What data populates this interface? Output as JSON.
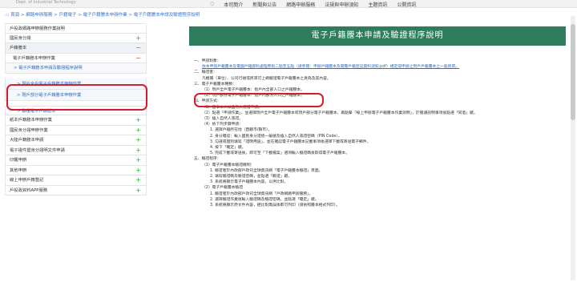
{
  "topbar": {
    "site_small_text": "Dept. of Industrial Technology",
    "nav": [
      "本司簡介",
      "新聞與公告",
      "網路申辦服務",
      "法規與申辦須知",
      "主題資訊",
      "公開資訊"
    ]
  },
  "breadcrumb": "::: 首頁 > 網路申辦服務 > 戶籍電子 > 電子戶籍謄本申辦作業 > 電子戶籍謄本申請及驗證程序說明",
  "sidebar": {
    "items": [
      {
        "label": "戶役政網路申辦服務作業說明",
        "sign": ""
      },
      {
        "label": "國民身分證",
        "sign": "+"
      },
      {
        "label": "戶籍謄本",
        "sign": "−"
      },
      {
        "label": "電子戶籍謄本申辦作業",
        "sign": "−"
      },
      {
        "label": "> 電子戶籍謄本申請及驗證程序說明",
        "sign": ""
      },
      {
        "label": "> 現戶全戶電子戶籍謄本申辦作業",
        "sign": ""
      },
      {
        "label": "> 現戶部分電子戶籍謄本申辦作業",
        "sign": ""
      },
      {
        "label": "> 驗證電子戶籍謄本",
        "sign": ""
      },
      {
        "label": "紙本戶籍謄本申辦作業",
        "sign": "+"
      },
      {
        "label": "國民身分證申辦作業",
        "sign": "+"
      },
      {
        "label": "大陸戶籍謄本申請",
        "sign": "+"
      },
      {
        "label": "電子證件暨身分證明文件申請",
        "sign": "+"
      },
      {
        "label": "印鑑申辦",
        "sign": "+"
      },
      {
        "label": "其他申辦",
        "sign": "+"
      },
      {
        "label": "線上申辦戶籍登記",
        "sign": "+"
      },
      {
        "label": "戶役政資料APP服務",
        "sign": "+"
      }
    ]
  },
  "main": {
    "banner": "電子戶籍謄本申請及驗證程序說明",
    "lines": [
      "一、申請對象：",
      "依本申辦戶籍謄本及電腦戶籍資料處理原則二點至五點（請參閱：申辦戶籍謄本及閱覽戶籍登記資料須知.pdf）規定得申辦之現戶戶籍謄本之一般民眾。",
      "二、驗證者：",
      "凡機關（單位）、公司行號或民眾可上網驗證電子戶籍謄本之真偽及其內容。",
      "三、電子戶籍謄本種類：",
      "（1）現戶全戶電子戶籍謄本：指戶內全部人口之戶籍謄本。",
      "（2）現戶部分電子戶籍謄本：指戶內部分人口之戶籍謄本。",
      "四、申請方式：",
      "（1）當事本人以自然人憑證申請。",
      "（2）點選「申請作業」，並選擇現戶全戶電子戶籍謄本或現戶部分電子戶籍謄本，再點擊「線上申辦電子戶籍謄本作業說明」，於閱讀說明事項後點選「同意」鍵。",
      "（3）插入自然人憑證。",
      "（4）依下列步驟申請：",
      "1. 選擇戶籍所在地（直轄市/縣市）。",
      "2. 身分確認：輸入國民身分證統一編號及插入自然人憑證密碼（PIN Code）。",
      "3. 勾選或個別填寫「證明用途」，並在確認電子戶籍謄本記載事項後選擇下載或寄送電子郵件。",
      "4. 按下「確定」鍵。",
      "5. 完成下載或寄送後，即可至「下載檔案」選項輸入驗證碼後取得電子戶籍謄本。",
      "五、驗證程序：",
      "（1）電子戶籍謄本驗證機制：",
      "1. 驗證者於內政部戶政司全球資訊網「電子戶籍謄本驗證」頁面。",
      "2. 填寫驗證碼及驗證密碼，並點選「驗證」鍵。",
      "3. 系統將顯示電子戶籍謄本內容，以供比對。",
      "（2）電子戶籍謄本驗證",
      "1. 驗證者於內政部戶政司全球資訊網「戶政網路申辦服務」。",
      "2. 選擇驗證作業後輸入驗證碼及驗證密碼，並點選「確定」鍵。",
      "3. 系統將顯示原文件內容，經比對無誤後即可列印（請依照謄本格式列印）。"
    ]
  }
}
